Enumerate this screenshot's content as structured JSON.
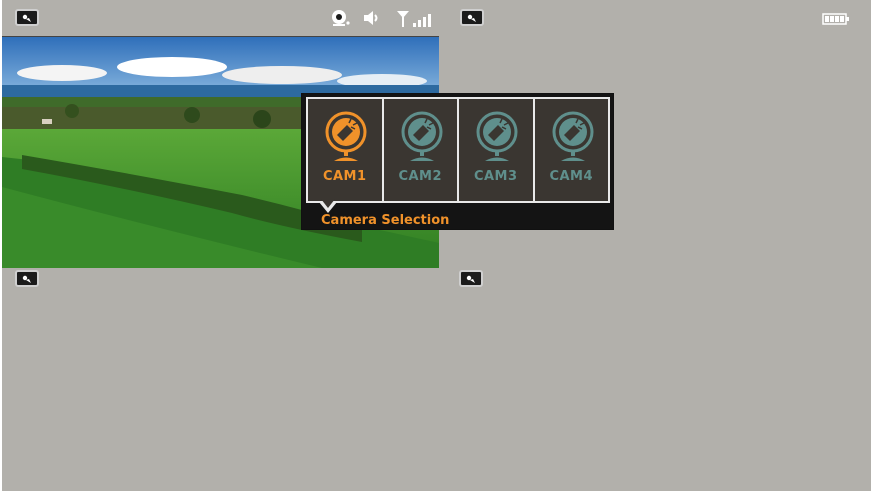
{
  "status_bar": {
    "icons": [
      "record-icon",
      "volume-icon",
      "signal-icon",
      "battery-icon"
    ]
  },
  "camera_badges": [
    "camera-badge-icon",
    "camera-badge-icon",
    "camera-badge-icon",
    "camera-badge-icon"
  ],
  "camera_selection": {
    "title": "Camera Selection",
    "selected": "CAM1",
    "cameras": [
      {
        "label": "CAM1"
      },
      {
        "label": "CAM2"
      },
      {
        "label": "CAM3"
      },
      {
        "label": "CAM4"
      }
    ]
  },
  "colors": {
    "background": "#b2b0ab",
    "active": "#f0922a",
    "inactive": "#5f8f8c",
    "cell_bg": "#3a3631"
  }
}
